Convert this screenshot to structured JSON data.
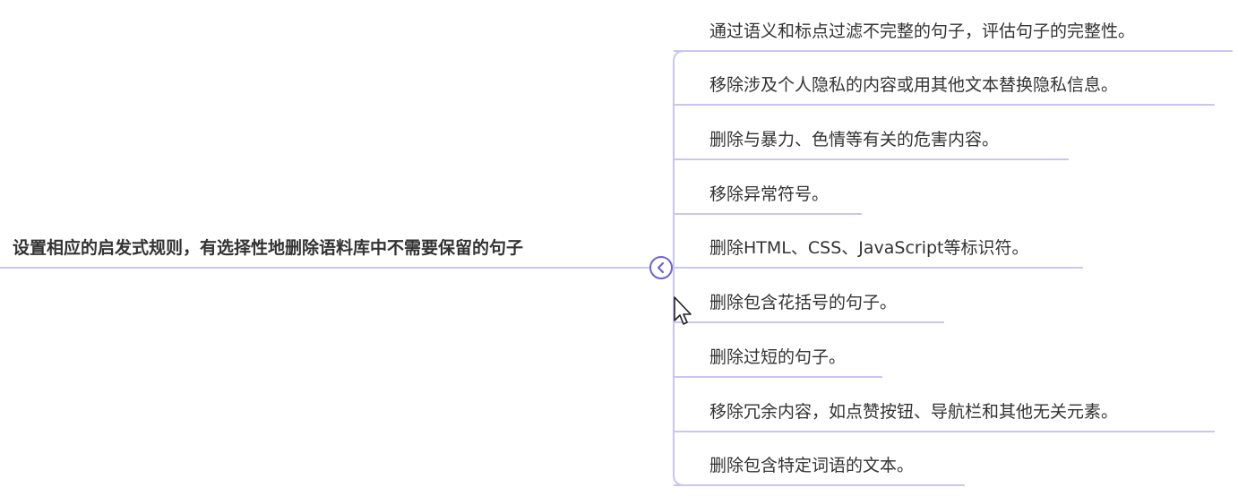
{
  "root": {
    "label": "设置相应的启发式规则，有选择性地删除语料库中不需要保留的句子"
  },
  "branches": [
    {
      "label": "通过语义和标点过滤不完整的句子，评估句子的完整性。"
    },
    {
      "label": "移除涉及个人隐私的内容或用其他文本替换隐私信息。"
    },
    {
      "label": "删除与暴力、色情等有关的危害内容。"
    },
    {
      "label": "移除异常符号。"
    },
    {
      "label": "删除HTML、CSS、JavaScript等标识符。"
    },
    {
      "label": "删除包含花括号的句子。"
    },
    {
      "label": "删除过短的句子。"
    },
    {
      "label": "移除冗余内容，如点赞按钮、导航栏和其他无关元素。"
    },
    {
      "label": "删除包含特定词语的文本。"
    }
  ],
  "colors": {
    "line": "#c9c6ef",
    "accent": "#6e63d9",
    "text": "#333333"
  },
  "icons": {
    "collapse": "chevron-left-icon",
    "cursor": "mouse-pointer-icon"
  }
}
